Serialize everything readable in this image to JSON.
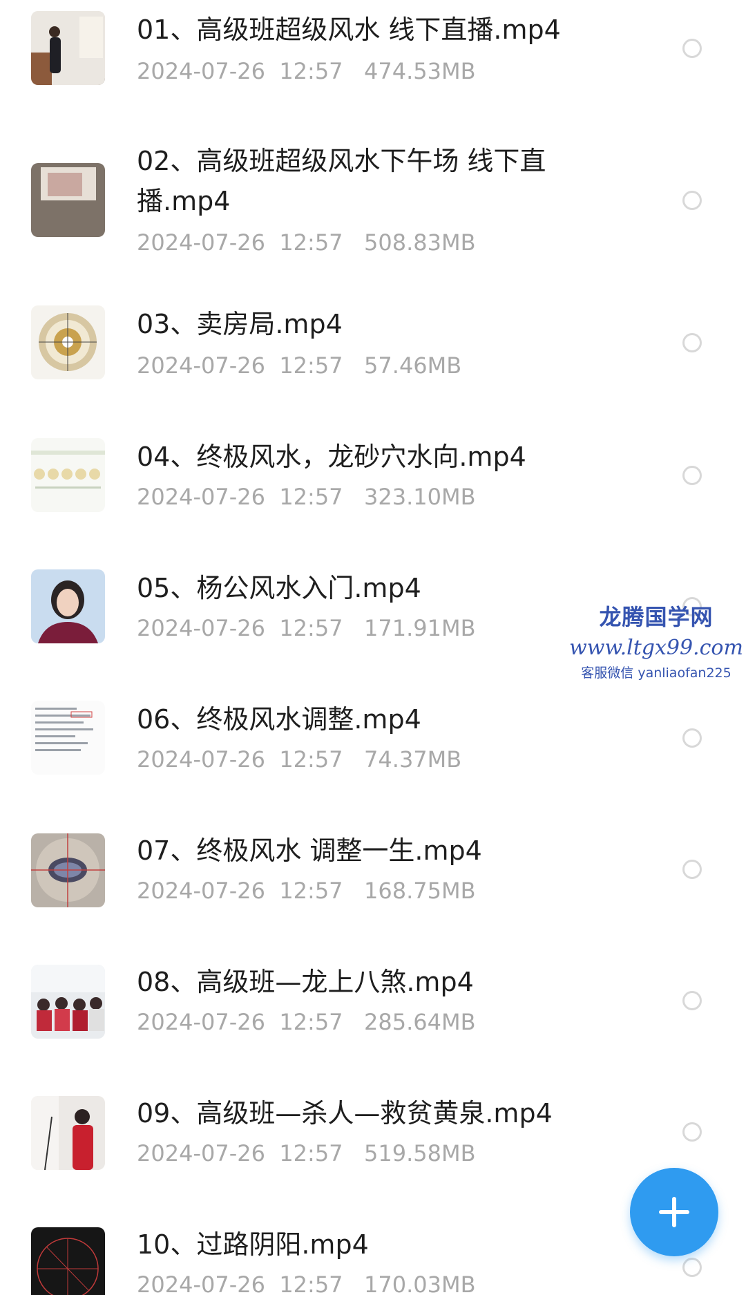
{
  "files": [
    {
      "name": "01、高级班超级风水 线下直播.mp4",
      "date": "2024-07-26",
      "time": "12:57",
      "size": "474.53MB"
    },
    {
      "name": "02、高级班超级风水下午场 线下直播.mp4",
      "date": "2024-07-26",
      "time": "12:57",
      "size": "508.83MB"
    },
    {
      "name": "03、卖房局.mp4",
      "date": "2024-07-26",
      "time": "12:57",
      "size": "57.46MB"
    },
    {
      "name": "04、终极风水，龙砂穴水向.mp4",
      "date": "2024-07-26",
      "time": "12:57",
      "size": "323.10MB"
    },
    {
      "name": "05、杨公风水入门.mp4",
      "date": "2024-07-26",
      "time": "12:57",
      "size": "171.91MB"
    },
    {
      "name": "06、终极风水调整.mp4",
      "date": "2024-07-26",
      "time": "12:57",
      "size": "74.37MB"
    },
    {
      "name": "07、终极风水 调整一生.mp4",
      "date": "2024-07-26",
      "time": "12:57",
      "size": "168.75MB"
    },
    {
      "name": "08、高级班—龙上八煞.mp4",
      "date": "2024-07-26",
      "time": "12:57",
      "size": "285.64MB"
    },
    {
      "name": "09、高级班—杀人—救贫黄泉.mp4",
      "date": "2024-07-26",
      "time": "12:57",
      "size": "519.58MB"
    },
    {
      "name": "10、过路阴阳.mp4",
      "date": "2024-07-26",
      "time": "12:57",
      "size": "170.03MB"
    }
  ],
  "watermark": {
    "title": "龙腾国学网",
    "url": "www.ltgx99.com",
    "contact": "客服微信 yanliaofan225"
  },
  "fab_icon": "plus-icon",
  "colors": {
    "accent": "#2f9bf0",
    "watermark": "#3554b0",
    "meta": "#a8a8a8"
  }
}
